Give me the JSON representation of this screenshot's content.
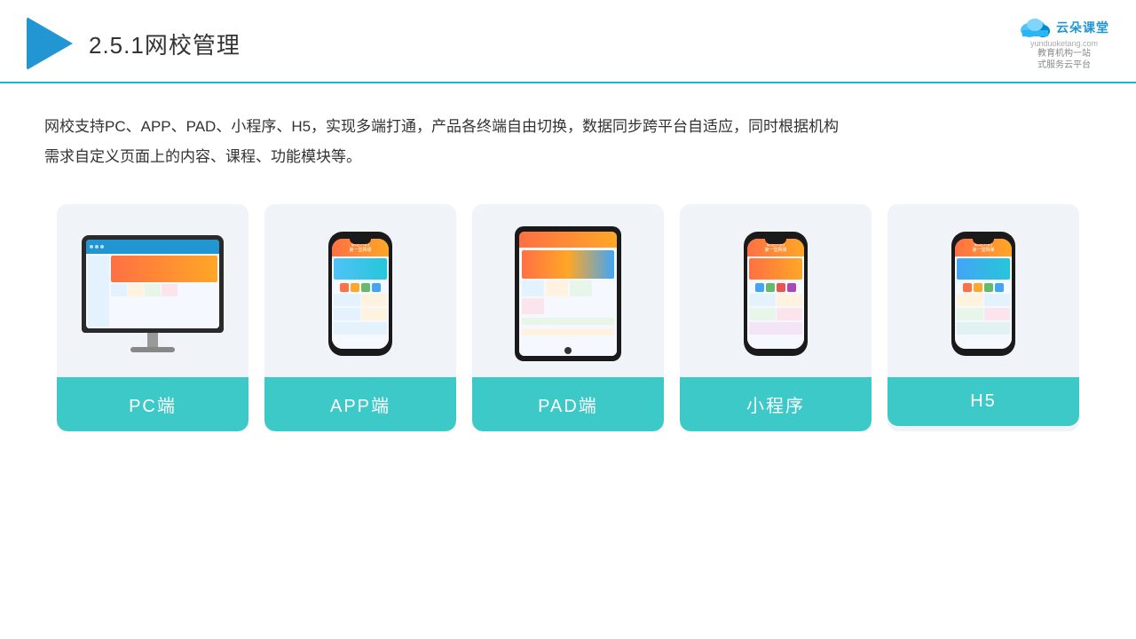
{
  "header": {
    "title_prefix": "2.5.1",
    "title_main": "网校管理",
    "brand_name": "云朵课堂",
    "brand_url": "yunduoketang.com",
    "brand_tagline_line1": "教育机构一站",
    "brand_tagline_line2": "式服务云平台"
  },
  "description": {
    "text": "网校支持PC、APP、PAD、小程序、H5，实现多端打通，产品各终端自由切换，数据同步跨平台自适应，同时根据机构需求自定义页面上的内容、课程、功能模块等。"
  },
  "cards": [
    {
      "label": "PC端",
      "type": "pc"
    },
    {
      "label": "APP端",
      "type": "phone"
    },
    {
      "label": "PAD端",
      "type": "tablet"
    },
    {
      "label": "小程序",
      "type": "phone2"
    },
    {
      "label": "H5",
      "type": "phone3"
    }
  ]
}
